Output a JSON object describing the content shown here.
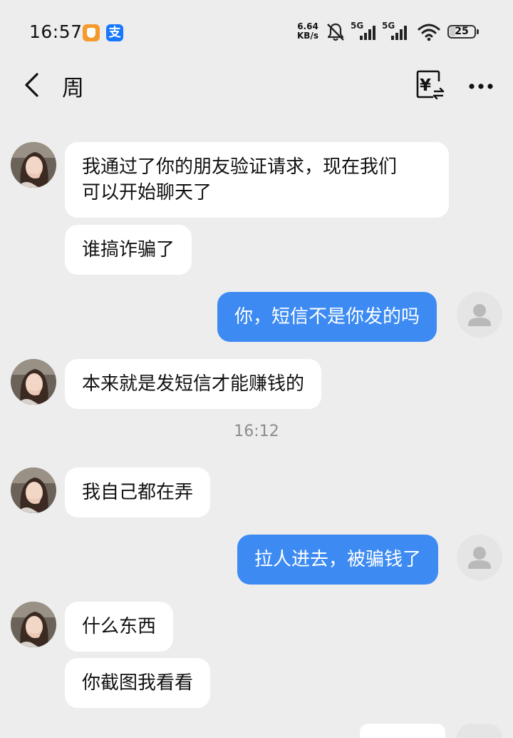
{
  "status_bar": {
    "time": "16:57",
    "net_speed_value": "6.64",
    "net_speed_unit": "KB/s",
    "signal_1_label": "5G",
    "signal_2_label": "5G",
    "battery": "25",
    "app_icons": [
      "orange-shield-app-icon",
      "alipay-icon"
    ],
    "alipay_glyph": "支"
  },
  "header": {
    "contact_name": "周",
    "transfer_icon_glyph": "¥"
  },
  "messages": [
    {
      "side": "in",
      "text": "我通过了你的朋友验证请求，现在我们\n可以开始聊天了"
    },
    {
      "side": "in",
      "text": "谁搞诈骗了"
    },
    {
      "side": "out",
      "text": "你，短信不是你发的吗"
    },
    {
      "side": "in",
      "text": "本来就是发短信才能赚钱的"
    },
    {
      "side": "in",
      "text": "我自己都在弄"
    },
    {
      "side": "out",
      "text": "拉人进去，被骗钱了"
    },
    {
      "side": "in",
      "text": "什么东西"
    },
    {
      "side": "in",
      "text": "你截图我看看"
    }
  ],
  "timestamp": "16:12",
  "colors": {
    "background": "#ededed",
    "incoming_bubble": "#ffffff",
    "outgoing_bubble": "#3d8bf2",
    "timestamp_text": "#8c8c8c"
  }
}
